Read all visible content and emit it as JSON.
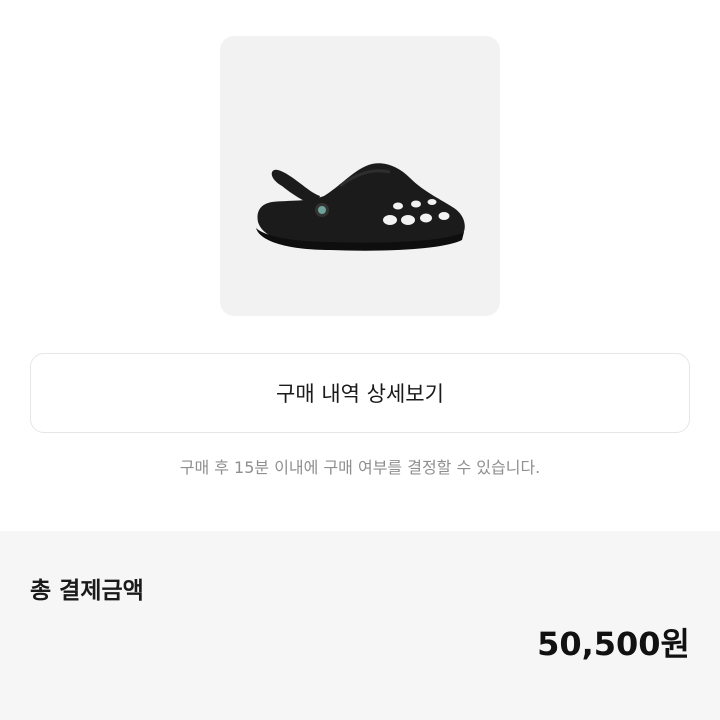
{
  "product": {
    "image_icon": "black-clog-shoe"
  },
  "detail_button": {
    "label": "구매 내역 상세보기"
  },
  "notice": {
    "text": "구매 후 15분 이내에 구매 여부를 결정할 수 있습니다."
  },
  "total": {
    "label": "총 결제금액",
    "amount": "50,500원"
  },
  "colors": {
    "card_bg": "#f2f2f2",
    "total_bg": "#f6f6f6",
    "notice_text": "#8f8f8f",
    "button_border": "#e6e6e6"
  }
}
